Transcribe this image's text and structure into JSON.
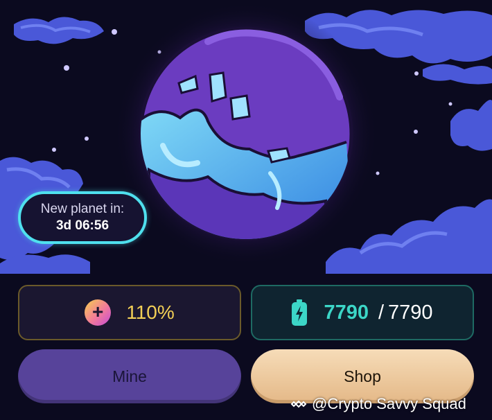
{
  "timer": {
    "label": "New planet in:",
    "value": "3d 06:56"
  },
  "boost": {
    "icon": "plus-icon",
    "value": "110%"
  },
  "energy": {
    "icon": "battery-icon",
    "current": "7790",
    "separator": "/",
    "max": "7790"
  },
  "actions": {
    "mine_label": "Mine",
    "shop_label": "Shop"
  },
  "watermark": {
    "text": "@Crypto Savvy Squad"
  },
  "colors": {
    "background": "#0b0a1f",
    "timer_border": "#4fe0ee",
    "boost_value": "#f2cf56",
    "energy_value": "#3cd6c7",
    "mine_button": "#57439a",
    "shop_button": "#ecc79c"
  }
}
